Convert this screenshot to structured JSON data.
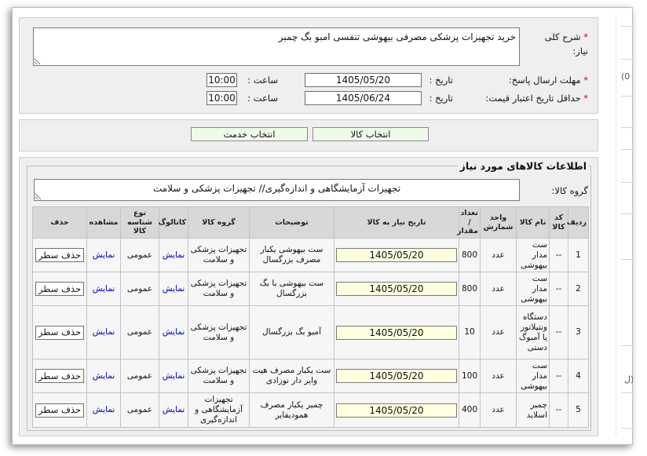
{
  "form": {
    "description": {
      "required_mark": "*",
      "label": "شرح کلی نیاز:",
      "value": "خرید تجهیزات پزشکی مصرفی بیهوشی تنفسی امبو بگ چمبر"
    },
    "deadline": {
      "required_mark": "*",
      "label": "مهلت ارسال پاسخ:",
      "date_label": "تاریخ :",
      "date": "1405/05/20",
      "time_label": "ساعت :",
      "time": "10:00"
    },
    "price_validity": {
      "required_mark": "*",
      "label": "حداقل تاریخ اعتبار قیمت:",
      "date_label": "تاریخ :",
      "date": "1405/06/24",
      "time_label": "ساعت :",
      "time": "10:00"
    }
  },
  "actions": {
    "select_goods": "انتخاب کالا",
    "select_service": "انتخاب خدمت"
  },
  "goods_section": {
    "legend": "اطلاعات کالاهای مورد نیاز",
    "group_label": "گروه کالا:",
    "group_value": "تجهیزات آزمایشگاهی و اندازه‌گیری// تجهیزات پزشکی و سلامت",
    "columns": {
      "row_no": "ردیف",
      "code": "کد کالا",
      "name": "نام کالا",
      "unit": "واحد شمارش",
      "quantity": "تعداد / مقدار",
      "need_date": "تاریخ نیاز به کالا",
      "description": "توضیحات",
      "group": "گروه کالا",
      "catalog": "کاتالوگ",
      "id_type": "نوع شناسه کالا",
      "view": "مشاهده",
      "delete": "حذف"
    },
    "rows": [
      {
        "row_no": "1",
        "code": "--",
        "name": "ست مدار بیهوشی",
        "unit": "عدد",
        "quantity": "800",
        "need_date": "1405/05/20",
        "description": "ست بیهوشی یکبار مصرف بزرگسال",
        "group": "تجهیزات پزشکی و سلامت",
        "catalog": "نمایش",
        "id_type": "عمومی",
        "view": "نمایش",
        "delete": "حذف سطر"
      },
      {
        "row_no": "2",
        "code": "--",
        "name": "ست مدار بیهوشی",
        "unit": "عدد",
        "quantity": "800",
        "need_date": "1405/05/20",
        "description": "ست بیهوشی با بگ بزرگسال",
        "group": "تجهیزات پزشکی و سلامت",
        "catalog": "نمایش",
        "id_type": "عمومی",
        "view": "نمایش",
        "delete": "حذف سطر"
      },
      {
        "row_no": "3",
        "code": "--",
        "name": "دستگاه ونتیلاتور یا آمبوگ دستی",
        "unit": "عدد",
        "quantity": "10",
        "need_date": "1405/05/20",
        "description": "آمبو بگ بزرگسال",
        "group": "تجهیزات پزشکی و سلامت",
        "catalog": "نمایش",
        "id_type": "عمومی",
        "view": "نمایش",
        "delete": "حذف سطر"
      },
      {
        "row_no": "4",
        "code": "--",
        "name": "ست مدار بیهوشی",
        "unit": "عدد",
        "quantity": "100",
        "need_date": "1405/05/20",
        "description": "ست یکبار مصرف هیت وایر دار نوزادی",
        "group": "تجهیزات پزشکی و سلامت",
        "catalog": "نمایش",
        "id_type": "عمومی",
        "view": "نمایش",
        "delete": "حذف سطر"
      },
      {
        "row_no": "5",
        "code": "--",
        "name": "چمبر اسلاید",
        "unit": "عدد",
        "quantity": "400",
        "need_date": "1405/05/20",
        "description": "چمبر یکبار مصرف همودیفایر",
        "group": "تجهیزات آزمایشگاهی و اندازه‌گیری",
        "catalog": "نمایش",
        "id_type": "عمومی",
        "view": "نمایش",
        "delete": "حذف سطر"
      }
    ]
  },
  "side_panel": {
    "text_top": "(0",
    "text_bottom": "ل)"
  },
  "colors": {
    "required": "#d00000",
    "link": "#0000d0",
    "date_field_bg": "#ffffe0",
    "button_bg": "#effbe9",
    "header_bg": "#d8d8d8",
    "panel_bg": "#efefef"
  }
}
